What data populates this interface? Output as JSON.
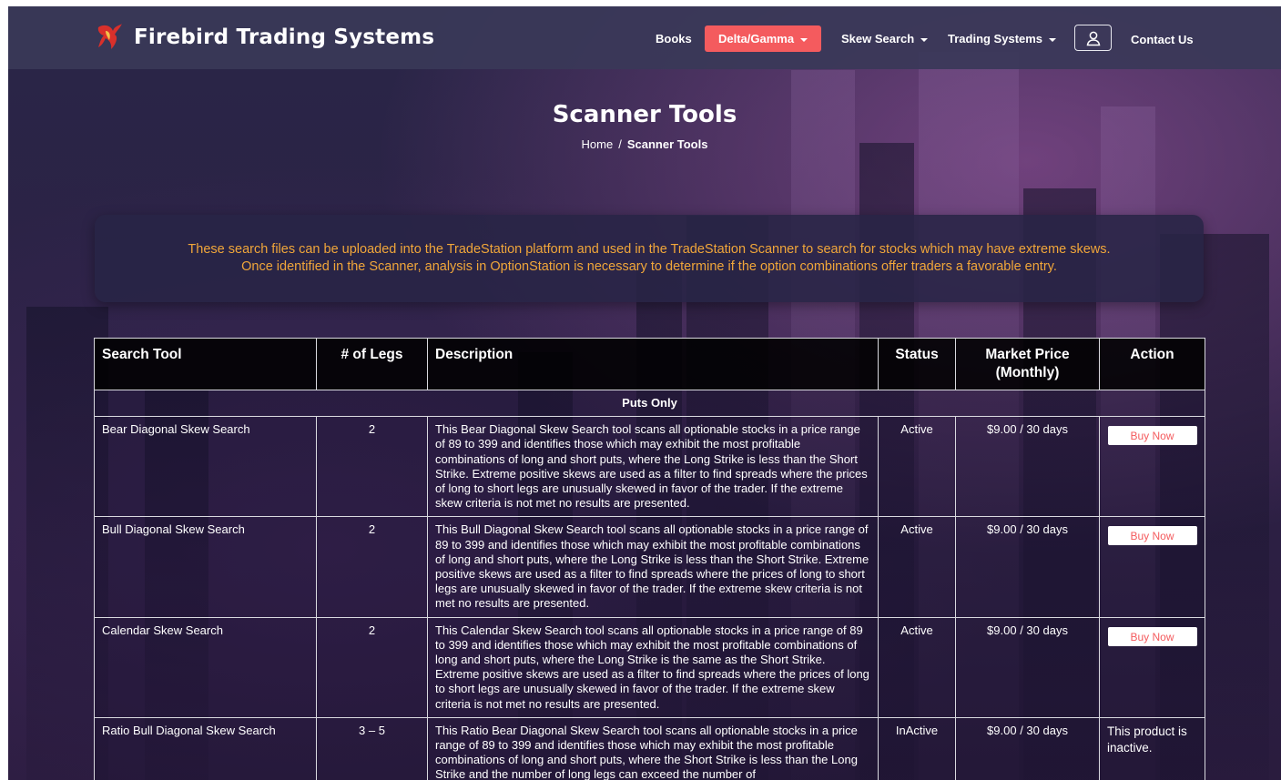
{
  "brand": {
    "name": "Firebird Trading Systems",
    "logo_icon": "phoenix-logo-icon"
  },
  "nav": {
    "items": [
      {
        "label": "Books",
        "dropdown": false
      },
      {
        "label": "Delta/Gamma",
        "dropdown": true,
        "active": true
      },
      {
        "label": "Skew Search",
        "dropdown": true
      },
      {
        "label": "Trading Systems",
        "dropdown": true
      }
    ],
    "user_icon": "user-icon",
    "contact_label": "Contact Us"
  },
  "page": {
    "title": "Scanner Tools",
    "breadcrumb": {
      "home": "Home",
      "separator": "/",
      "current": "Scanner Tools"
    }
  },
  "notice": {
    "line1": "These search files can be uploaded into the TradeStation platform and used in the TradeStation Scanner to search for stocks which may have extreme skews.",
    "line2": "Once identified in the Scanner, analysis in OptionStation is necessary to determine if the option combinations offer traders a favorable entry."
  },
  "table": {
    "headers": {
      "tool": "Search Tool",
      "legs": "# of Legs",
      "description": "Description",
      "status": "Status",
      "price": "Market Price (Monthly)",
      "action": "Action"
    },
    "section": "Puts Only",
    "rows": [
      {
        "tool": "Bear Diagonal Skew Search",
        "legs": "2",
        "description": "This Bear Diagonal Skew Search tool scans all optionable stocks in a price range of 89 to 399 and identifies those which may exhibit the most profitable combinations of long and short puts, where the Long Strike is less than the Short Strike. Extreme positive skews are used as a filter to find spreads where the prices of long to short legs are unusually skewed in favor of the trader. If the extreme skew criteria is not met no results are presented.",
        "status": "Active",
        "price": "$9.00 / 30 days",
        "action": "Buy Now"
      },
      {
        "tool": "Bull Diagonal Skew Search",
        "legs": "2",
        "description": "This Bull Diagonal Skew Search tool scans all optionable stocks in a price range of 89 to 399 and identifies those which may exhibit the most profitable combinations of long and short puts, where the Long Strike is less than the Short Strike. Extreme positive skews are used as a filter to find spreads where the prices of long to short legs are unusually skewed in favor of the trader. If the extreme skew criteria is not met no results are presented.",
        "status": "Active",
        "price": "$9.00 / 30 days",
        "action": "Buy Now"
      },
      {
        "tool": "Calendar Skew Search",
        "legs": "2",
        "description": "This Calendar Skew Search tool scans all optionable stocks in a price range of 89 to 399 and identifies those which may exhibit the most profitable combinations of long and short puts, where the Long Strike is the same as the Short Strike. Extreme positive skews are used as a filter to find spreads where the prices of long to short legs are unusually skewed in favor of the trader. If the extreme skew criteria is not met no results are presented.",
        "status": "Active",
        "price": "$9.00 / 30 days",
        "action": "Buy Now"
      },
      {
        "tool": "Ratio Bull Diagonal Skew Search",
        "legs": "3 – 5",
        "description": "This Ratio Bear Diagonal Skew Search tool scans all optionable stocks in a price range of 89 to 399 and identifies those which may exhibit the most profitable combinations of long and short puts, where the Short Strike is less than the Long Strike and the number of long legs can exceed the number of",
        "status": "InActive",
        "price": "$9.00 / 30 days",
        "action": "This product is inactive."
      }
    ]
  },
  "colors": {
    "accent": "#f45b5e",
    "notice_text": "#f0a63a",
    "nav_bg": "#3a3858"
  }
}
